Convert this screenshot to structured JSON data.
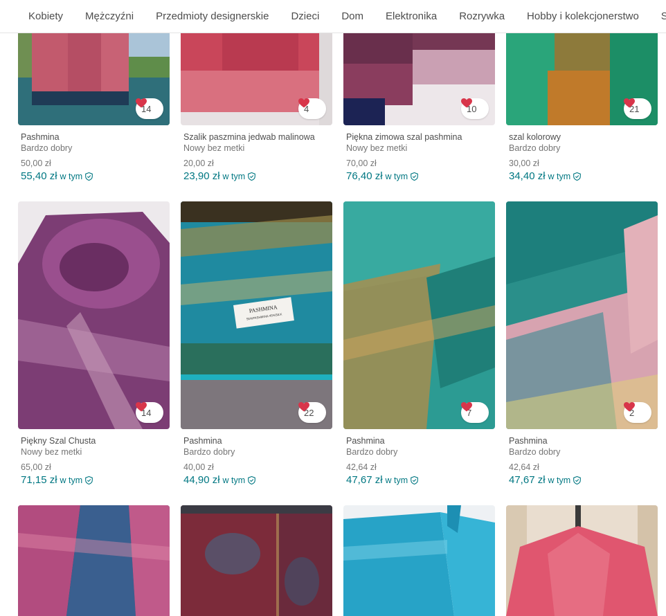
{
  "nav": {
    "items": [
      "Kobiety",
      "Mężczyźni",
      "Przedmioty designerskie",
      "Dzieci",
      "Dom",
      "Elektronika",
      "Rozrywka",
      "Hobby i kolekcjonerstwo",
      "Sport"
    ]
  },
  "colors": {
    "accent": "#007782",
    "heart": "#d8354a",
    "text": "#4d4d4d",
    "muted": "#757575"
  },
  "items": [
    {
      "title": "Pashmina",
      "condition": "Bardzo dobry",
      "price": "50,00 zł",
      "total": "55,40 zł",
      "incl": "w tym",
      "favorites": "14"
    },
    {
      "title": "Szalik paszmina jedwab malinowa",
      "condition": "Nowy bez metki",
      "price": "20,00 zł",
      "total": "23,90 zł",
      "incl": "w tym",
      "favorites": "4"
    },
    {
      "title": "Piękna zimowa szal pashmina",
      "condition": "Nowy bez metki",
      "price": "70,00 zł",
      "total": "76,40 zł",
      "incl": "w tym",
      "favorites": "10"
    },
    {
      "title": "szal kolorowy",
      "condition": "Bardzo dobry",
      "price": "30,00 zł",
      "total": "34,40 zł",
      "incl": "w tym",
      "favorites": "21"
    },
    {
      "title": "Piękny Szal Chusta",
      "condition": "Nowy bez metki",
      "price": "65,00 zł",
      "total": "71,15 zł",
      "incl": "w tym",
      "favorites": "14"
    },
    {
      "title": "Pashmina",
      "condition": "Bardzo dobry",
      "price": "40,00 zł",
      "total": "44,90 zł",
      "incl": "w tym",
      "favorites": "22"
    },
    {
      "title": "Pashmina",
      "condition": "Bardzo dobry",
      "price": "42,64 zł",
      "total": "47,67 zł",
      "incl": "w tym",
      "favorites": "7"
    },
    {
      "title": "Pashmina",
      "condition": "Bardzo dobry",
      "price": "42,64 zł",
      "total": "47,67 zł",
      "incl": "w tym",
      "favorites": "2"
    },
    {
      "title": "",
      "condition": "",
      "price": "",
      "total": "",
      "incl": "",
      "favorites": ""
    },
    {
      "title": "",
      "condition": "",
      "price": "",
      "total": "",
      "incl": "",
      "favorites": ""
    },
    {
      "title": "",
      "condition": "",
      "price": "",
      "total": "",
      "incl": "",
      "favorites": ""
    },
    {
      "title": "",
      "condition": "",
      "price": "",
      "total": "",
      "incl": "",
      "favorites": ""
    }
  ],
  "label_text": "PASHMINA",
  "label_subtext": "55%PASHMINA 45%SILK"
}
